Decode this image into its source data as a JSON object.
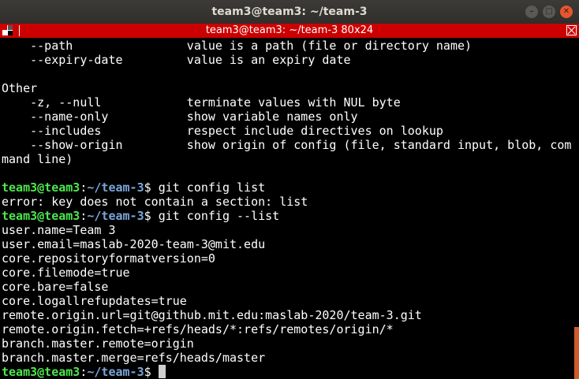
{
  "window": {
    "title": "team3@team3: ~/team-3"
  },
  "statusbar": {
    "text": "team3@team3: ~/team-3 80x24"
  },
  "terminal": {
    "lines": [
      {
        "type": "text",
        "text": "    --path                value is a path (file or directory name)"
      },
      {
        "type": "text",
        "text": "    --expiry-date         value is an expiry date"
      },
      {
        "type": "text",
        "text": ""
      },
      {
        "type": "text",
        "text": "Other"
      },
      {
        "type": "text",
        "text": "    -z, --null            terminate values with NUL byte"
      },
      {
        "type": "text",
        "text": "    --name-only           show variable names only"
      },
      {
        "type": "text",
        "text": "    --includes            respect include directives on lookup"
      },
      {
        "type": "text",
        "text": "    --show-origin         show origin of config (file, standard input, blob, com"
      },
      {
        "type": "text",
        "text": "mand line)"
      },
      {
        "type": "text",
        "text": ""
      },
      {
        "type": "prompt",
        "user": "team3@team3",
        "sep": ":",
        "path": "~/team-3",
        "dollar": "$ ",
        "cmd": "git config list"
      },
      {
        "type": "text",
        "text": "error: key does not contain a section: list"
      },
      {
        "type": "prompt",
        "user": "team3@team3",
        "sep": ":",
        "path": "~/team-3",
        "dollar": "$ ",
        "cmd": "git config --list"
      },
      {
        "type": "text",
        "text": "user.name=Team 3"
      },
      {
        "type": "text",
        "text": "user.email=maslab-2020-team-3@mit.edu"
      },
      {
        "type": "text",
        "text": "core.repositoryformatversion=0"
      },
      {
        "type": "text",
        "text": "core.filemode=true"
      },
      {
        "type": "text",
        "text": "core.bare=false"
      },
      {
        "type": "text",
        "text": "core.logallrefupdates=true"
      },
      {
        "type": "text",
        "text": "remote.origin.url=git@github.mit.edu:maslab-2020/team-3.git"
      },
      {
        "type": "text",
        "text": "remote.origin.fetch=+refs/heads/*:refs/remotes/origin/*"
      },
      {
        "type": "text",
        "text": "branch.master.remote=origin"
      },
      {
        "type": "text",
        "text": "branch.master.merge=refs/heads/master"
      },
      {
        "type": "prompt",
        "user": "team3@team3",
        "sep": ":",
        "path": "~/team-3",
        "dollar": "$ ",
        "cmd": "",
        "cursor": true
      }
    ]
  },
  "colors": {
    "prompt_user": "#4ee64e",
    "prompt_path": "#7aa6da",
    "statusbar_bg": "#cc0000",
    "terminal_bg": "#000000",
    "close_button": "#e6552f"
  },
  "icons": {
    "minimize": "minimize-icon",
    "maximize": "maximize-icon",
    "close": "close-icon"
  }
}
